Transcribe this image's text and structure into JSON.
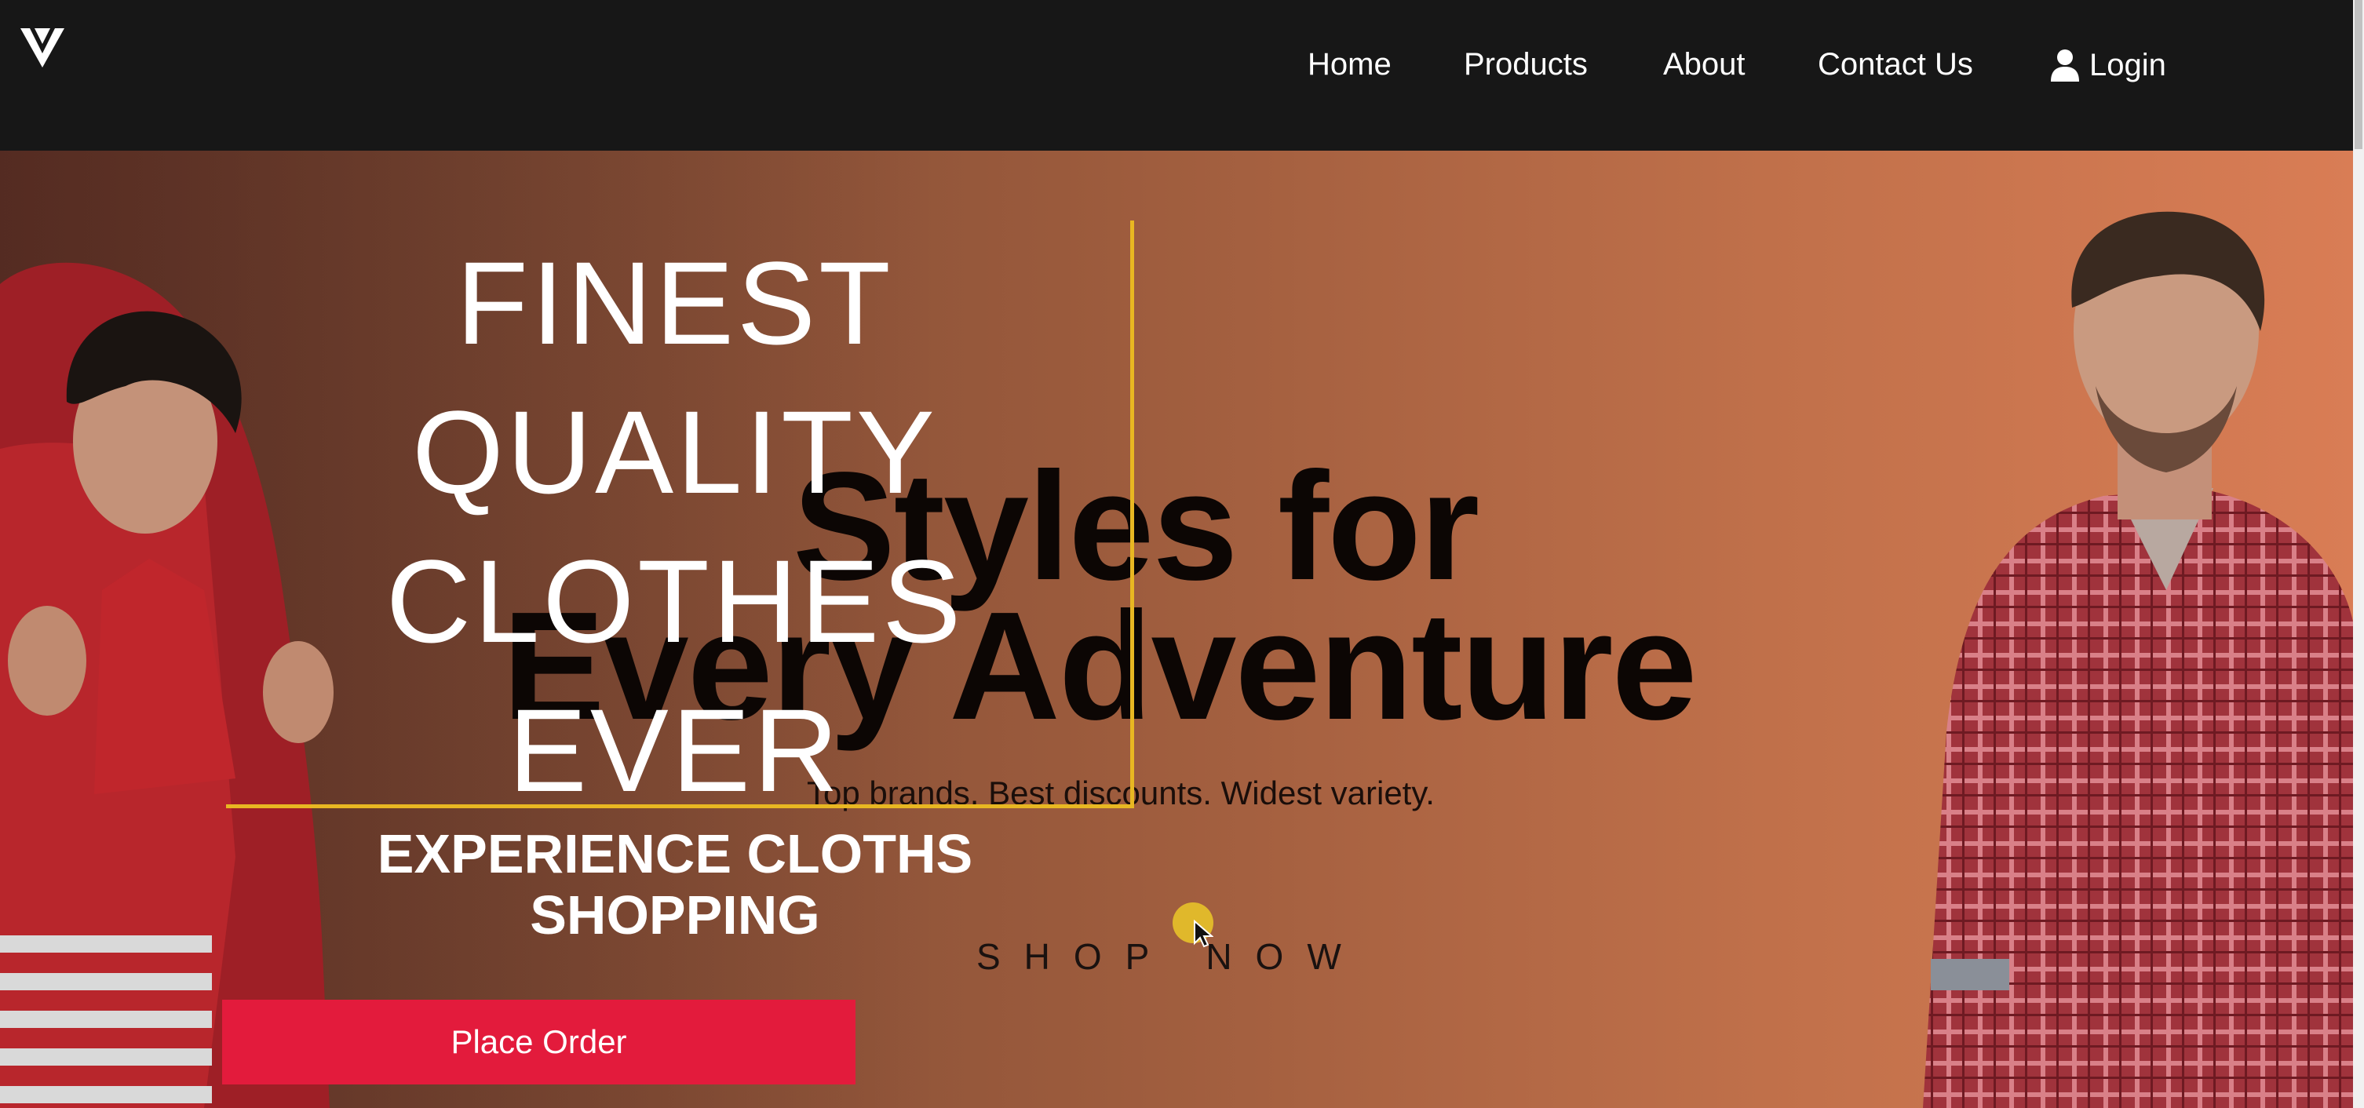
{
  "nav": {
    "logo_icon": "v-logo-icon",
    "items": [
      "Home",
      "Products",
      "About",
      "Contact Us"
    ],
    "login_label": "Login",
    "login_icon": "user-icon"
  },
  "hero": {
    "tagline": [
      "FINEST",
      "QUALITY",
      "CLOTHES",
      "EVER"
    ],
    "subheading_line1": "EXPERIENCE CLOTHS",
    "subheading_line2": "SHOPPING",
    "cta_label": "Place Order",
    "banner": {
      "headline_line1": "Styles for",
      "headline_line2": "Every Adventure",
      "subline": "Top brands. Best discounts. Widest variety.",
      "shop_now": "SHOP NOW"
    }
  },
  "colors": {
    "navbar": "#171717",
    "accent_frame": "#e8b722",
    "cta": "#e31b3c",
    "hero_gradient_start": "#6c3d2e",
    "hero_gradient_end": "#d97d55"
  }
}
